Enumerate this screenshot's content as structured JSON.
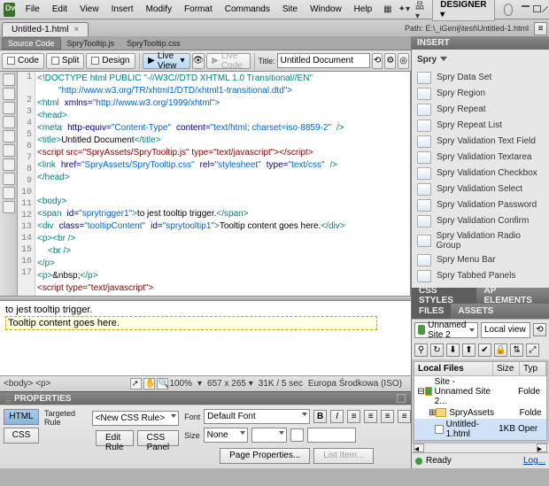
{
  "menu": {
    "items": [
      "File",
      "Edit",
      "View",
      "Insert",
      "Modify",
      "Format",
      "Commands",
      "Site",
      "Window",
      "Help"
    ],
    "designer": "DESIGNER"
  },
  "doc": {
    "tab": "Untitled-1.html",
    "close": "×",
    "path": "Path: E:\\_iGenij\\test\\Untitled-1.html"
  },
  "subtabs": {
    "t1": "Source Code",
    "t2": "SpryTooltip.js",
    "t3": "SpryTooltip.css"
  },
  "toolbar": {
    "code": "Code",
    "split": "Split",
    "design": "Design",
    "liveview": "Live View",
    "livecode": "Live Code",
    "title_label": "Title:",
    "title_val": "Untitled Document"
  },
  "code_lines": {
    "l1": "<!DOCTYPE html PUBLIC \"-//W3C//DTD XHTML 1.0 Transitional//EN\"",
    "l1b": "\"http://www.w3.org/TR/xhtml1/DTD/xhtml1-transitional.dtd\">",
    "l2": "<html xmlns=\"http://www.w3.org/1999/xhtml\">",
    "l3": "<head>",
    "l4": "<meta http-equiv=\"Content-Type\" content=\"text/html; charset=iso-8859-2\" />",
    "l5": "<title>Untitled Document</title>",
    "l6a": "<script src=\"SpryAssets/SpryTooltip.js\" type=\"text/javascript\">",
    "l6b": "</script>",
    "l7": "<link href=\"SpryAssets/SpryTooltip.css\" rel=\"stylesheet\" type=\"text/css\" />",
    "l8": "</head>",
    "l10": "<body>",
    "l11": "<span id=\"sprytrigger1\">to jest tooltip trigger.</span>",
    "l12": "<div class=\"tooltipContent\" id=\"sprytooltip1\">Tooltip content goes here.</div>",
    "l13": "<p><br />",
    "l14": "  <br />",
    "l15": "</p>",
    "l16": "<p>&nbsp;</p>",
    "l17": "<script type=\"text/javascript\">"
  },
  "design": {
    "trigger": "to jest tooltip trigger.",
    "tooltip": "Tooltip content goes here."
  },
  "status": {
    "tag": "<body> <p>",
    "zoom": "100%",
    "dims": "657 x 265",
    "stats": "31K / 5 sec",
    "enc": "Europa Środkowa (ISO)"
  },
  "props": {
    "title": "PROPERTIES",
    "html": "HTML",
    "css": "CSS",
    "targeted": "Targeted Rule",
    "rule": "<New CSS Rule>",
    "edit": "Edit Rule",
    "csspanel": "CSS Panel",
    "font": "Font",
    "fontval": "Default Font",
    "size": "Size",
    "sizeval": "None",
    "pageprops": "Page Properties...",
    "listitem": "List Item..."
  },
  "insert": {
    "title": "INSERT",
    "cat": "Spry",
    "items": [
      "Spry Data Set",
      "Spry Region",
      "Spry Repeat",
      "Spry Repeat List",
      "Spry Validation Text Field",
      "Spry Validation Textarea",
      "Spry Validation Checkbox",
      "Spry Validation Select",
      "Spry Validation Password",
      "Spry Validation Confirm",
      "Spry Validation Radio Group",
      "Spry Menu Bar",
      "Spry Tabbed Panels"
    ]
  },
  "panels": {
    "cssstyles": "CSS STYLES",
    "apelements": "AP ELEMENTS",
    "files": "FILES",
    "assets": "ASSETS"
  },
  "files": {
    "site": "Unnamed Site 2",
    "view": "Local view",
    "h1": "Local Files",
    "h2": "Size",
    "h3": "Typ",
    "r1": "Site - Unnamed Site 2...",
    "r1t": "Folde",
    "r2": "SpryAssets",
    "r2t": "Folde",
    "r3": "Untitled-1.html",
    "r3s": "1KB",
    "r3t": "Oper"
  },
  "ready": {
    "label": "Ready",
    "log": "Log..."
  }
}
